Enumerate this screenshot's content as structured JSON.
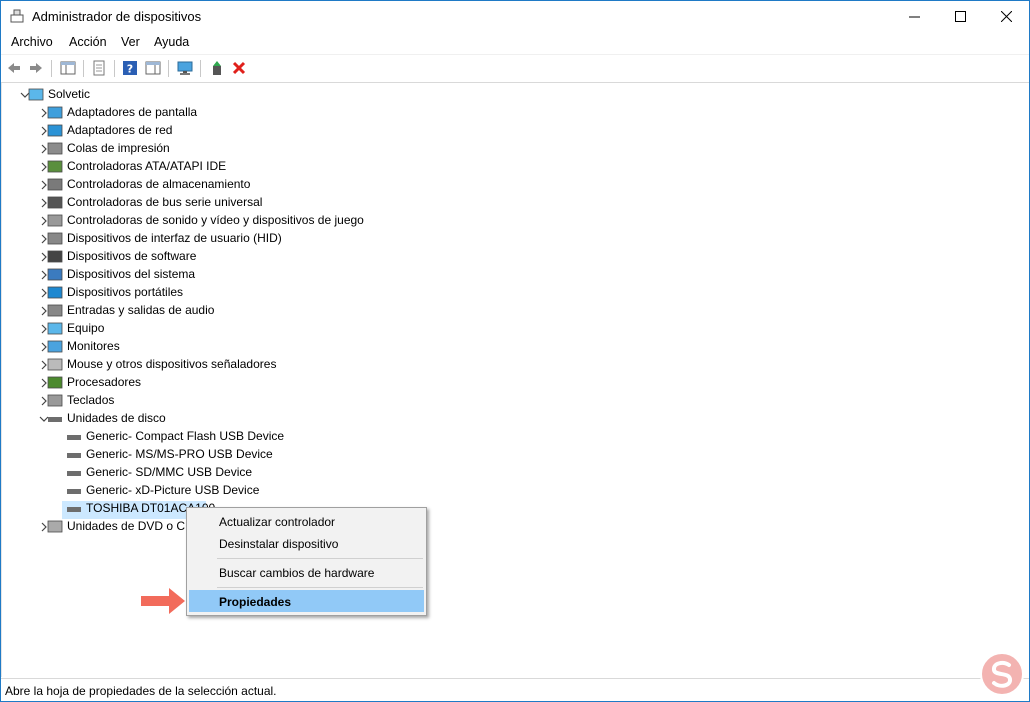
{
  "window": {
    "title": "Administrador de dispositivos"
  },
  "menu": [
    "Archivo",
    "Acción",
    "Ver",
    "Ayuda"
  ],
  "tree": {
    "root": "Solvetic",
    "categories": [
      {
        "label": "Adaptadores de pantalla",
        "icon": "display-adapter-icon"
      },
      {
        "label": "Adaptadores de red",
        "icon": "network-adapter-icon"
      },
      {
        "label": "Colas de impresión",
        "icon": "printer-icon"
      },
      {
        "label": "Controladoras ATA/ATAPI IDE",
        "icon": "ide-controller-icon"
      },
      {
        "label": "Controladoras de almacenamiento",
        "icon": "storage-controller-icon"
      },
      {
        "label": "Controladoras de bus serie universal",
        "icon": "usb-icon"
      },
      {
        "label": "Controladoras de sonido y vídeo y dispositivos de juego",
        "icon": "speaker-icon"
      },
      {
        "label": "Dispositivos de interfaz de usuario (HID)",
        "icon": "hid-icon"
      },
      {
        "label": "Dispositivos de software",
        "icon": "software-device-icon"
      },
      {
        "label": "Dispositivos del sistema",
        "icon": "system-device-icon"
      },
      {
        "label": "Dispositivos portátiles",
        "icon": "portable-device-icon"
      },
      {
        "label": "Entradas y salidas de audio",
        "icon": "audio-io-icon"
      },
      {
        "label": "Equipo",
        "icon": "computer-icon"
      },
      {
        "label": "Monitores",
        "icon": "monitor-icon"
      },
      {
        "label": "Mouse y otros dispositivos señaladores",
        "icon": "mouse-icon"
      },
      {
        "label": "Procesadores",
        "icon": "processor-icon"
      },
      {
        "label": "Teclados",
        "icon": "keyboard-icon"
      },
      {
        "label": "Unidades de disco",
        "icon": "disk-drive-icon",
        "expanded": true
      },
      {
        "label": "Unidades de DVD o CD-ROM",
        "icon": "dvd-drive-icon"
      }
    ],
    "disk_children": [
      "Generic- Compact Flash USB Device",
      "Generic- MS/MS-PRO USB Device",
      "Generic- SD/MMC USB Device",
      "Generic- xD-Picture USB Device",
      "TOSHIBA DT01ACA100"
    ]
  },
  "context_menu": {
    "items": [
      "Actualizar controlador",
      "Desinstalar dispositivo",
      "Buscar cambios de hardware",
      "Propiedades"
    ],
    "highlighted": "Propiedades"
  },
  "status": "Abre la hoja de propiedades de la selección actual.",
  "colors": {
    "selection": "#cce8ff",
    "menu_highlight": "#91c9f7",
    "arrow": "#f26b5b",
    "window_border": "#1f7ac6"
  }
}
